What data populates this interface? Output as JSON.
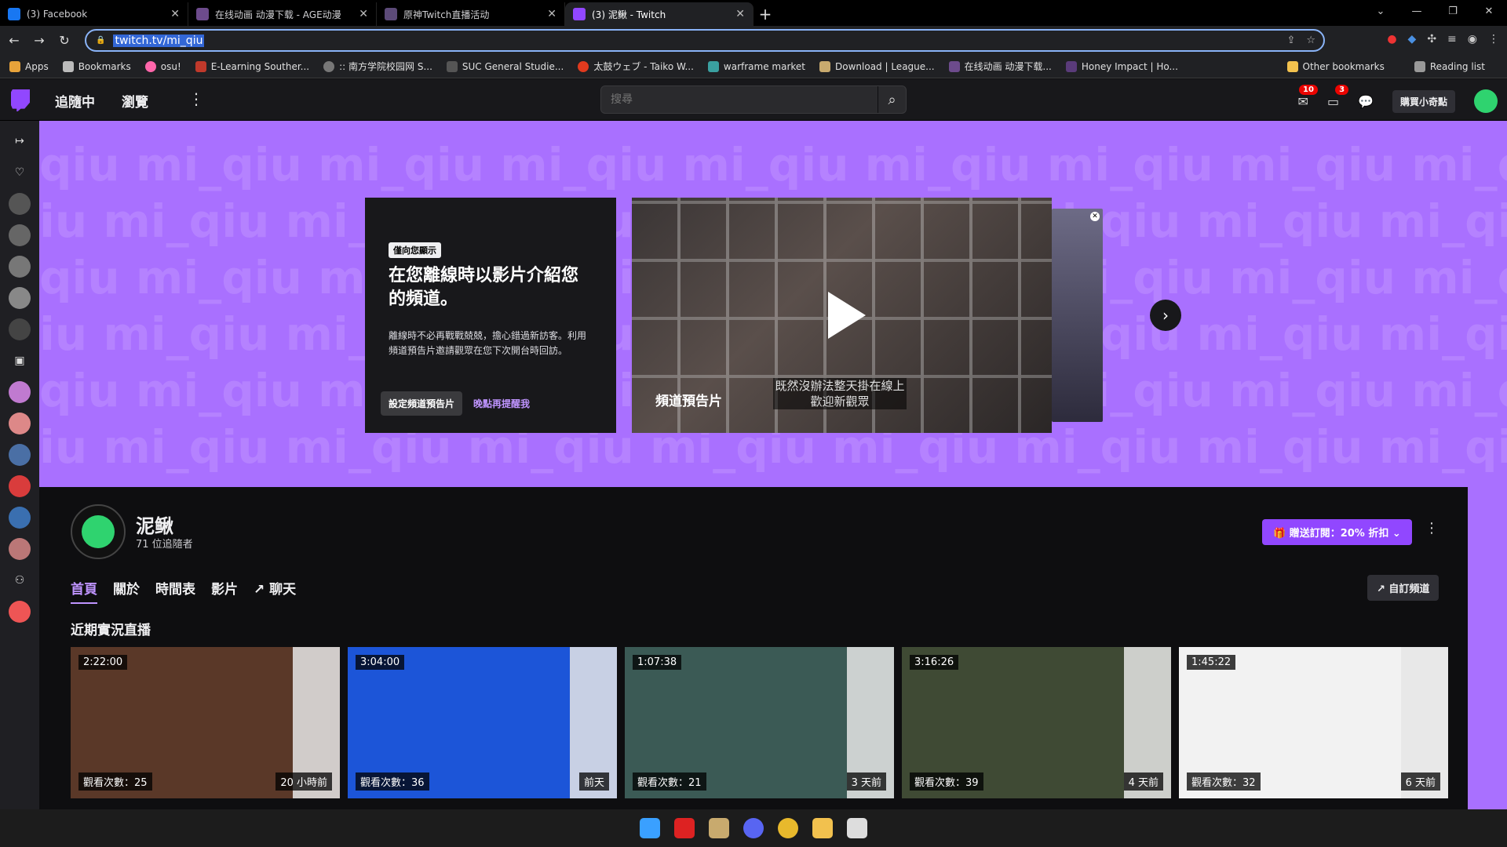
{
  "browser": {
    "tabs": [
      {
        "title": "(3) Facebook",
        "color": "#1877f2"
      },
      {
        "title": "在线动画 动漫下载 - AGE动漫",
        "color": "#6d4b8c"
      },
      {
        "title": "原神Twitch直播活动",
        "color": "#5c4a78"
      },
      {
        "title": "(3) 泥鳅 - Twitch",
        "color": "#9147ff"
      }
    ],
    "url": "twitch.tv/mi_qiu",
    "bookmarks": [
      "Apps",
      "Bookmarks",
      "osu!",
      "E-Learning Souther...",
      ":: 南方学院校园网 S...",
      "SUC General Studie...",
      "太鼓ウェブ - Taiko W...",
      "warframe market",
      "Download | League...",
      "在线动画 动漫下载...",
      "Honey Impact | Ho..."
    ],
    "bookmarks_right": [
      "Other bookmarks",
      "Reading list"
    ]
  },
  "twitch": {
    "nav": {
      "following": "追隨中",
      "browse": "瀏覽"
    },
    "search_placeholder": "搜尋",
    "notifications_count": "10",
    "inbox_count": "3",
    "bits_label": "購買小奇點"
  },
  "banner": {
    "bg_text": "mi_qiu",
    "tag": "僅向您顯示",
    "heading": "在您離線時以影片介紹您的頻道。",
    "body": "離線時不必再戰戰兢兢，擔心錯過新訪客。利用頻道預告片邀請觀眾在您下次開台時回訪。",
    "set_trailer": "設定頻道預告片",
    "remind_later": "晚點再提醒我",
    "trailer_label": "頻道預告片",
    "trailer_sub": "既然沒辦法整天掛在線上 歡迎新觀眾"
  },
  "channel": {
    "name": "泥鳅",
    "followers": "71 位追隨者",
    "gift_sub": "贈送訂閱：20% 折扣",
    "tabs": [
      "首頁",
      "關於",
      "時間表",
      "影片",
      "聊天"
    ],
    "customize": "自訂頻道",
    "recent_title": "近期實況直播",
    "vods": [
      {
        "duration": "2:22:00",
        "views": "觀看次數：25",
        "ago": "20 小時前",
        "bg": "#5a3828"
      },
      {
        "duration": "3:04:00",
        "views": "觀看次數：36",
        "ago": "前天",
        "bg": "#1c55d8"
      },
      {
        "duration": "1:07:38",
        "views": "觀看次數：21",
        "ago": "3 天前",
        "bg": "#3b5a55"
      },
      {
        "duration": "3:16:26",
        "views": "觀看次數：39",
        "ago": "4 天前",
        "bg": "#3f4a34"
      },
      {
        "duration": "1:45:22",
        "views": "觀看次數：32",
        "ago": "6 天前",
        "bg": "#f2f2f2"
      }
    ]
  }
}
